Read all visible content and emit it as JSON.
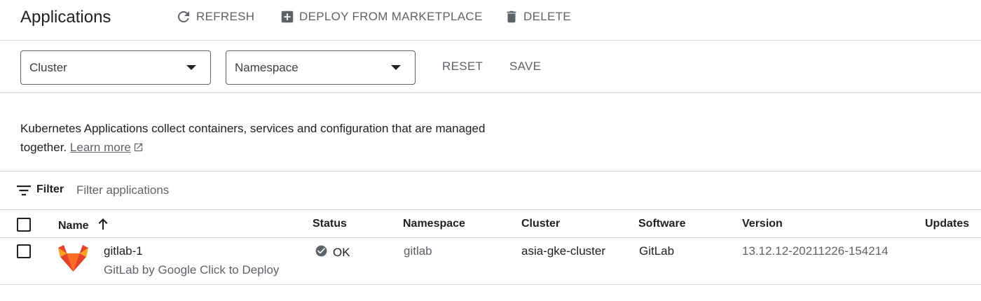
{
  "header": {
    "title": "Applications",
    "refresh_label": "REFRESH",
    "deploy_label": "DEPLOY FROM MARKETPLACE",
    "delete_label": "DELETE"
  },
  "filters": {
    "cluster_label": "Cluster",
    "namespace_label": "Namespace",
    "reset_label": "RESET",
    "save_label": "SAVE"
  },
  "info": {
    "text": "Kubernetes Applications collect containers, services and configuration that are managed together.",
    "link_label": "Learn more"
  },
  "filter_bar": {
    "label": "Filter",
    "placeholder": "Filter applications"
  },
  "table": {
    "columns": {
      "name": "Name",
      "status": "Status",
      "namespace": "Namespace",
      "cluster": "Cluster",
      "software": "Software",
      "version": "Version",
      "updates": "Updates"
    },
    "rows": [
      {
        "name": "gitlab-1",
        "description": "GitLab by Google Click to Deploy",
        "status": "OK",
        "namespace": "gitlab",
        "cluster": "asia-gke-cluster",
        "software": "GitLab",
        "version": "13.12.12-20211226-154214",
        "updates": ""
      }
    ]
  },
  "icons": {
    "refresh": "refresh-icon",
    "add_box": "add-box-icon",
    "delete": "trash-icon",
    "filter": "filter-list-icon",
    "sort": "arrow-up-icon",
    "status_ok": "check-circle-icon",
    "app_logo": "gitlab-logo-icon",
    "external_link": "open-in-new-icon"
  },
  "colors": {
    "gitlab_orange": "#e24329",
    "icon_gray": "#5f6368",
    "divider": "#dadce0"
  }
}
